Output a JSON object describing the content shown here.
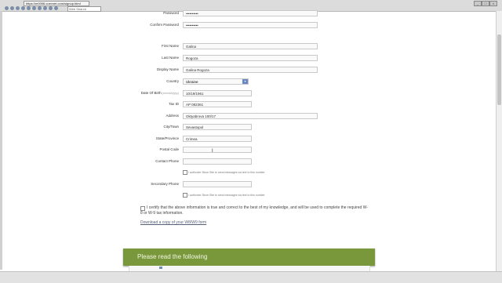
{
  "browser": {
    "url": "https://m0096.coevnet.com/signup.html",
    "search_placeholder": "Web Search"
  },
  "form": {
    "password": {
      "label": "Password",
      "value": "••••••••••"
    },
    "confirm_password": {
      "label": "Confirm Password",
      "value": "••••••••••"
    },
    "first_name": {
      "label": "First Name",
      "value": "Galina"
    },
    "last_name": {
      "label": "Last Name",
      "value": "Rogoza"
    },
    "display_name": {
      "label": "Display Name",
      "value": "Galina Rogoza"
    },
    "country": {
      "label": "Country",
      "value": "Ukraine"
    },
    "dob": {
      "label": "Date Of Birth",
      "hint": "(mm/dd/yyyy)",
      "value": "10/19/1961"
    },
    "tax_id": {
      "label": "Tax ID",
      "value": "AP 082361"
    },
    "address": {
      "label": "Address",
      "value": "Oktyabrova 100/17"
    },
    "city": {
      "label": "City/Town",
      "value": "Sevastopol"
    },
    "state": {
      "label": "State/Province",
      "value": "Crimea"
    },
    "postal": {
      "label": "Postal Code",
      "value": ""
    },
    "contact_phone": {
      "label": "Contact Phone",
      "value": ""
    },
    "contact_sms_note": "I authorize Since Site to send messages via text to this number",
    "secondary_phone": {
      "label": "Secondary Phone",
      "value": ""
    },
    "secondary_sms_note": "I authorize Since Site to send messages via text to this number"
  },
  "certify_text": "I certify that the above information is true and correct to the best of my knowledge, and will be used to complete the required W-8 or W-9 tax information.",
  "download_link": "Download a copy of your W8/W9 form",
  "banner_title": "Please read the following",
  "accent": "#79983b"
}
